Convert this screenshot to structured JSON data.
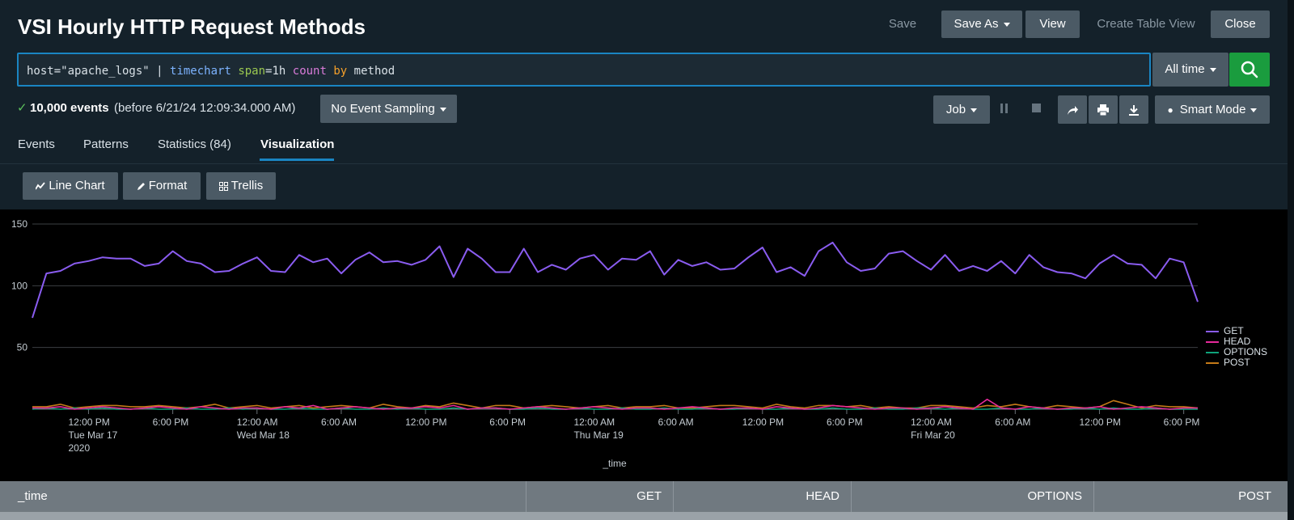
{
  "header": {
    "title": "VSI Hourly HTTP Request Methods",
    "save": "Save",
    "save_as": "Save As",
    "view": "View",
    "create_table_view": "Create Table View",
    "close": "Close"
  },
  "search": {
    "query_parts": {
      "host": "host=\"apache_logs\"",
      "pipe": " | ",
      "command": "timechart",
      "arg_key": "span",
      "arg_val": "=1h",
      "func": "count",
      "by": "by",
      "field": "method"
    },
    "time_range": "All time",
    "search_icon": "search-icon"
  },
  "status": {
    "events": "10,000 events",
    "before": "(before 6/21/24 12:09:34.000 AM)",
    "sampling": "No Event Sampling",
    "job": "Job",
    "mode": "Smart Mode"
  },
  "tabs": [
    {
      "label": "Events"
    },
    {
      "label": "Patterns"
    },
    {
      "label": "Statistics (84)"
    },
    {
      "label": "Visualization"
    }
  ],
  "viz_buttons": {
    "line_chart": "Line Chart",
    "format": "Format",
    "trellis": "Trellis"
  },
  "colors": {
    "GET": "#8a5cf0",
    "HEAD": "#e6299a",
    "OPTIONS": "#0fa37a",
    "POST": "#c57a18"
  },
  "chart_data": {
    "type": "line",
    "xlabel": "_time",
    "ylim": [
      0,
      150
    ],
    "yticks": [
      50,
      100,
      150
    ],
    "x_hours_start_label": "Tue Mar 17 2020",
    "x_ticks": [
      {
        "hour": 12,
        "label": [
          "12:00 PM",
          "Tue Mar 17",
          "2020"
        ]
      },
      {
        "hour": 18,
        "label": [
          "6:00 PM"
        ]
      },
      {
        "hour": 24,
        "label": [
          "12:00 AM",
          "Wed Mar 18"
        ]
      },
      {
        "hour": 30,
        "label": [
          "6:00 AM"
        ]
      },
      {
        "hour": 36,
        "label": [
          "12:00 PM"
        ]
      },
      {
        "hour": 42,
        "label": [
          "6:00 PM"
        ]
      },
      {
        "hour": 48,
        "label": [
          "12:00 AM",
          "Thu Mar 19"
        ]
      },
      {
        "hour": 54,
        "label": [
          "6:00 AM"
        ]
      },
      {
        "hour": 60,
        "label": [
          "12:00 PM"
        ]
      },
      {
        "hour": 66,
        "label": [
          "6:00 PM"
        ]
      },
      {
        "hour": 72,
        "label": [
          "12:00 AM",
          "Fri Mar 20"
        ]
      },
      {
        "hour": 78,
        "label": [
          "6:00 AM"
        ]
      },
      {
        "hour": 84,
        "label": [
          "12:00 PM"
        ]
      },
      {
        "hour": 90,
        "label": [
          "6:00 PM"
        ]
      }
    ],
    "x_start_hour": 8,
    "series": [
      {
        "name": "GET",
        "values": [
          74,
          110,
          112,
          118,
          120,
          123,
          122,
          122,
          116,
          118,
          128,
          120,
          118,
          111,
          112,
          118,
          123,
          112,
          111,
          125,
          119,
          122,
          110,
          121,
          127,
          119,
          120,
          117,
          121,
          132,
          107,
          130,
          122,
          111,
          111,
          130,
          111,
          117,
          113,
          122,
          125,
          113,
          122,
          121,
          128,
          109,
          121,
          116,
          119,
          113,
          114,
          123,
          131,
          111,
          115,
          108,
          128,
          135,
          119,
          112,
          114,
          126,
          128,
          120,
          113,
          125,
          112,
          116,
          112,
          120,
          110,
          125,
          115,
          111,
          110,
          106,
          118,
          125,
          118,
          117,
          106,
          122,
          119,
          87
        ]
      },
      {
        "name": "HEAD",
        "values": [
          1,
          1,
          2,
          0,
          1,
          2,
          1,
          0,
          1,
          2,
          1,
          0,
          2,
          1,
          0,
          1,
          1,
          0,
          2,
          1,
          3,
          0,
          1,
          2,
          1,
          0,
          1,
          1,
          2,
          1,
          3,
          0,
          1,
          1,
          0,
          1,
          2,
          1,
          0,
          1,
          2,
          1,
          0,
          1,
          1,
          0,
          1,
          2,
          1,
          0,
          1,
          1,
          0,
          2,
          1,
          0,
          1,
          3,
          2,
          1,
          0,
          1,
          1,
          0,
          1,
          2,
          1,
          0,
          8,
          1,
          0,
          2,
          1,
          0,
          1,
          1,
          2,
          0,
          1,
          2,
          1,
          0,
          1,
          1
        ]
      },
      {
        "name": "OPTIONS",
        "values": [
          0,
          1,
          0,
          1,
          0,
          1,
          0,
          0,
          1,
          0,
          0,
          1,
          0,
          0,
          1,
          0,
          1,
          0,
          0,
          1,
          0,
          0,
          1,
          0,
          0,
          1,
          0,
          1,
          0,
          0,
          1,
          0,
          1,
          1,
          0,
          0,
          1,
          0,
          0,
          1,
          0,
          0,
          1,
          0,
          0,
          1,
          0,
          0,
          1,
          0,
          0,
          1,
          0,
          0,
          1,
          0,
          0,
          1,
          0,
          0,
          1,
          0,
          0,
          1,
          1,
          0,
          1,
          0,
          0,
          1,
          0,
          0,
          1,
          0,
          0,
          1,
          0,
          1,
          0,
          0,
          1,
          0,
          0,
          0
        ]
      },
      {
        "name": "POST",
        "values": [
          2,
          2,
          4,
          1,
          2,
          3,
          3,
          2,
          2,
          3,
          2,
          1,
          2,
          4,
          1,
          2,
          3,
          1,
          2,
          3,
          1,
          2,
          3,
          2,
          1,
          4,
          2,
          1,
          3,
          2,
          5,
          3,
          1,
          3,
          3,
          1,
          2,
          3,
          2,
          1,
          2,
          3,
          1,
          2,
          2,
          3,
          1,
          1,
          2,
          3,
          3,
          2,
          1,
          4,
          2,
          1,
          3,
          3,
          2,
          3,
          1,
          2,
          1,
          1,
          3,
          3,
          2,
          1,
          3,
          2,
          4,
          2,
          1,
          3,
          2,
          1,
          2,
          7,
          4,
          1,
          3,
          2,
          2,
          1
        ]
      }
    ]
  },
  "table": {
    "columns": [
      "_time",
      "GET",
      "HEAD",
      "OPTIONS",
      "POST"
    ]
  }
}
